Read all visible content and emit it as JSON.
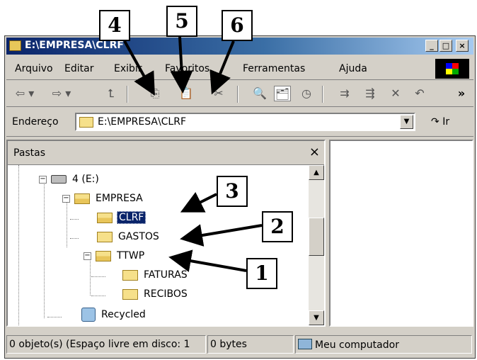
{
  "window": {
    "title": "E:\\EMPRESA\\CLRF",
    "controls": {
      "minimize": "_",
      "maximize": "□",
      "close": "×"
    }
  },
  "menu": [
    "Arquivo",
    "Editar",
    "Exibir",
    "Favoritos",
    "Ferramentas",
    "Ajuda"
  ],
  "toolbar": {
    "back": "⇦ ▾",
    "forward": "⇨ ▾",
    "up": "⮤",
    "copy": "⎘",
    "paste": "📋",
    "cut": "✂",
    "search": "🔍",
    "folders": "🗂",
    "history": "◷",
    "move_to": "⇉",
    "copy_to": "⇶",
    "delete": "✕",
    "undo": "↶",
    "more": "»"
  },
  "address": {
    "label": "Endereço",
    "value": "E:\\EMPRESA\\CLRF",
    "go": "Ir"
  },
  "folders_pane": {
    "title": "Pastas",
    "close": "×",
    "tree": [
      {
        "label": "4 (E:)",
        "expander": "−"
      },
      {
        "label": "EMPRESA",
        "expander": "−"
      },
      {
        "label": "CLRF",
        "selected": true
      },
      {
        "label": "GASTOS"
      },
      {
        "label": "TTWP",
        "expander": "−"
      },
      {
        "label": "FATURAS"
      },
      {
        "label": "RECIBOS"
      },
      {
        "label": "Recycled"
      }
    ]
  },
  "statusbar": {
    "objects": "0 objeto(s) (Espaço livre em disco: 1",
    "size": "0 bytes",
    "zone": "Meu computador"
  },
  "callouts": [
    "1",
    "2",
    "3",
    "4",
    "5",
    "6"
  ]
}
